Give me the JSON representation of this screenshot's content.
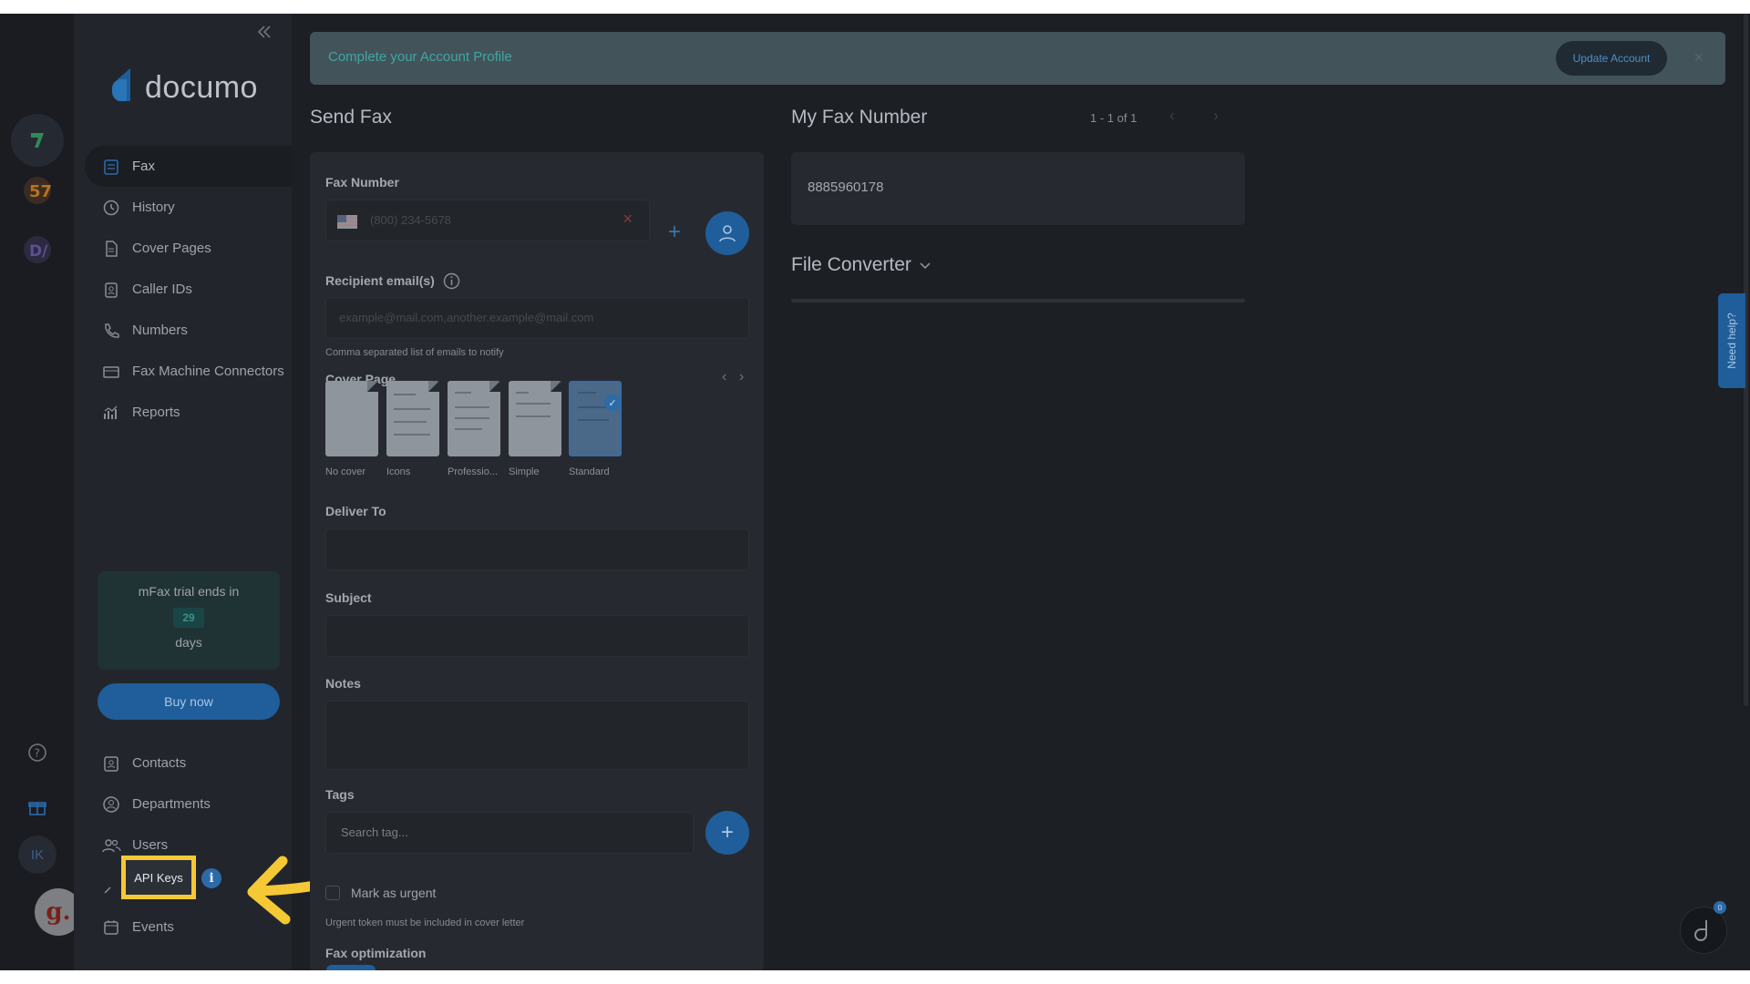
{
  "banner": {
    "text": "Complete your Account Profile",
    "button_label": "Update Account",
    "close": "×"
  },
  "sidebar": {
    "logo": "documo",
    "nav": [
      {
        "label": "Fax",
        "icon": "fax-icon"
      },
      {
        "label": "History",
        "icon": "history-icon"
      },
      {
        "label": "Cover Pages",
        "icon": "document-icon"
      },
      {
        "label": "Caller IDs",
        "icon": "badge-icon"
      },
      {
        "label": "Numbers",
        "icon": "phone-icon"
      },
      {
        "label": "Fax Machine Connectors",
        "icon": "fax-machine-icon"
      },
      {
        "label": "Reports",
        "icon": "chart-icon"
      }
    ],
    "trial": {
      "prefix": "mFax trial ends in",
      "days": "29",
      "suffix": "days"
    },
    "buy_label": "Buy now",
    "bottom_nav": [
      {
        "label": "Contacts",
        "icon": "contacts-icon"
      },
      {
        "label": "Departments",
        "icon": "departments-icon"
      },
      {
        "label": "Users",
        "icon": "users-icon"
      },
      {
        "label": "API Keys",
        "icon": "key-icon"
      },
      {
        "label": "Events",
        "icon": "calendar-icon"
      }
    ],
    "api_info": "i"
  },
  "rail": {
    "avatar_initials": "IK",
    "user_avatar": "g."
  },
  "send_fax": {
    "title": "Send Fax",
    "fax_number_label": "Fax Number",
    "fax_number_placeholder": "(800) 234-5678",
    "recipient_label": "Recipient email(s)",
    "recipient_placeholder": "example@mail.com,another.example@mail.com",
    "recipient_hint": "Comma separated list of emails to notify",
    "cover_page_label": "Cover Page",
    "covers": [
      {
        "label": "No cover"
      },
      {
        "label": "Icons"
      },
      {
        "label": "Professio..."
      },
      {
        "label": "Simple"
      },
      {
        "label": "Standard",
        "selected": true
      }
    ],
    "deliver_to_label": "Deliver To",
    "subject_label": "Subject",
    "notes_label": "Notes",
    "tags_label": "Tags",
    "tags_placeholder": "Search tag...",
    "urgent_label": "Mark as urgent",
    "urgent_hint": "Urgent token must be included in cover letter",
    "optimization_label": "Fax optimization"
  },
  "my_fax": {
    "title": "My Fax Number",
    "pagination": "1 - 1 of 1",
    "number": "8885960178",
    "file_converter": "File Converter"
  },
  "help_tab": "Need help?",
  "chat_badge": "0",
  "colors": {
    "accent": "#1f5e9a",
    "highlight": "#f5c935",
    "teal": "#3fa7a0"
  }
}
